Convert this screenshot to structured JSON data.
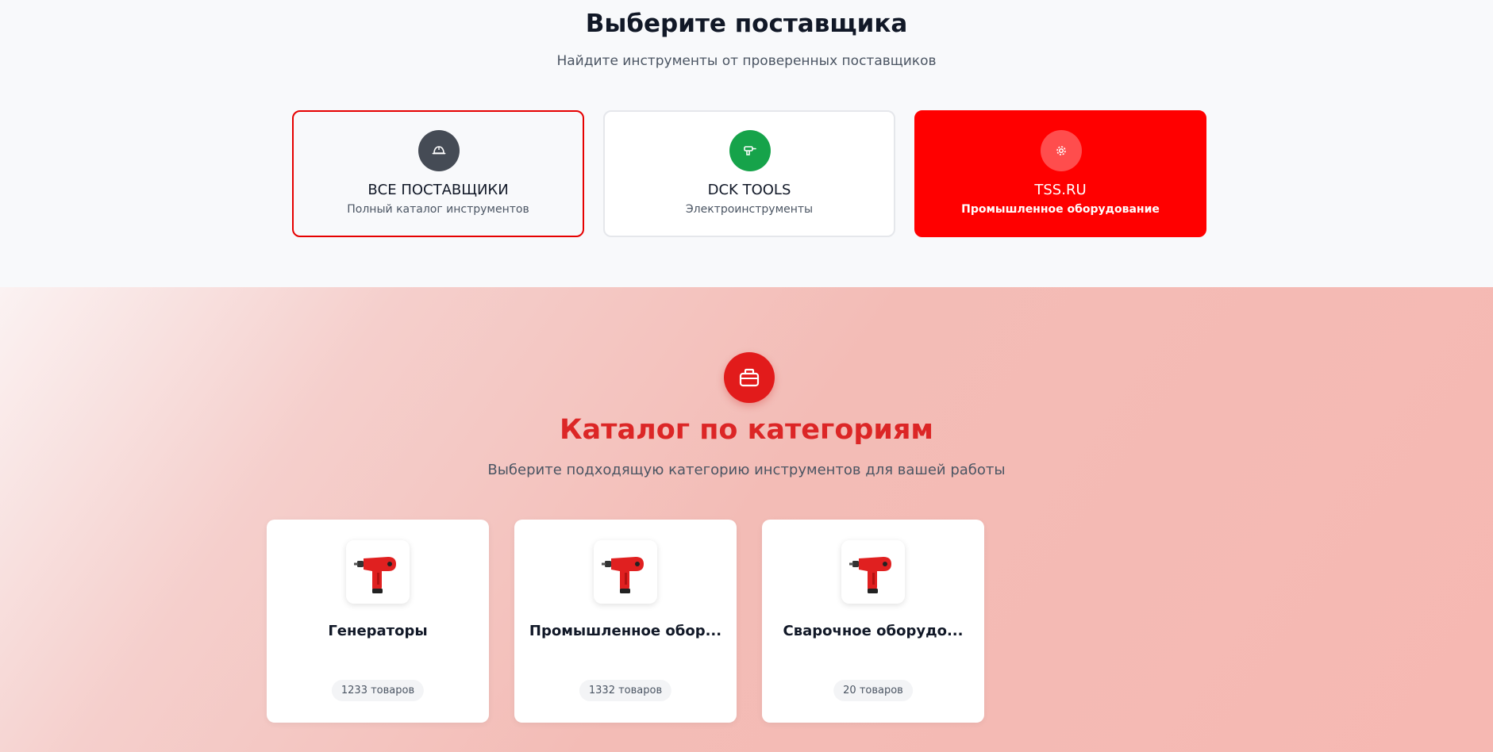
{
  "suppliers_section": {
    "title": "Выберите поставщика",
    "subtitle": "Найдите инструменты от проверенных поставщиков",
    "cards": [
      {
        "name": "ВСЕ ПОСТАВЩИКИ",
        "description": "Полный каталог инструментов",
        "icon": "hard-hat-icon",
        "icon_color": "#454b55",
        "selected": true
      },
      {
        "name": "DCK TOOLS",
        "description": "Электроинструменты",
        "icon": "drill-icon",
        "icon_color": "#16a34a"
      },
      {
        "name": "TSS.RU",
        "description": "Промышленное оборудование",
        "icon": "gear-icon",
        "icon_color": "#ff4d4d",
        "background": "#ff0000"
      }
    ]
  },
  "catalog_section": {
    "icon": "toolbox-icon",
    "title": "Каталог по категориям",
    "subtitle": "Выберите подходящую категорию инструментов для вашей работы",
    "categories": [
      {
        "name": "Генераторы",
        "count": "1233 товаров",
        "image": "drill-image"
      },
      {
        "name": "Промышленное обор...",
        "count": "1332 товаров",
        "image": "drill-image"
      },
      {
        "name": "Сварочное оборудо...",
        "count": "20 товаров",
        "image": "drill-image"
      }
    ]
  },
  "colors": {
    "accent_red": "#dc2626",
    "tss_red": "#ff0000",
    "dark_text": "#111827"
  }
}
